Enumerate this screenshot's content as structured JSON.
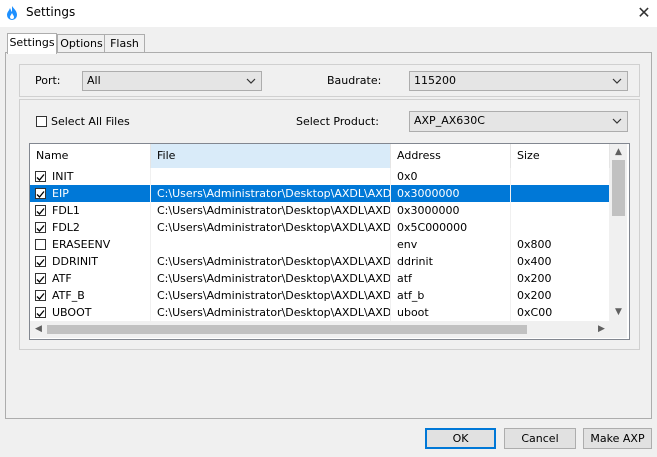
{
  "window": {
    "title": "Settings",
    "close_glyph": "✕"
  },
  "tabs": [
    "Settings",
    "Options",
    "Flash"
  ],
  "port": {
    "label": "Port:",
    "value": "All"
  },
  "baudrate": {
    "label": "Baudrate:",
    "value": "115200"
  },
  "select_all": {
    "label": "Select All Files",
    "checked": false
  },
  "product": {
    "label": "Select Product:",
    "value": "AXP_AX630C"
  },
  "table": {
    "columns": [
      "Name",
      "File",
      "Address",
      "Size"
    ],
    "rows": [
      {
        "checked": true,
        "name": "INIT",
        "file": "",
        "address": "0x0",
        "size": "",
        "selected": false
      },
      {
        "checked": true,
        "name": "EIP",
        "file": "C:\\Users\\Administrator\\Desktop\\AXDL\\AXDL...",
        "address": "0x3000000",
        "size": "",
        "selected": true
      },
      {
        "checked": true,
        "name": "FDL1",
        "file": "C:\\Users\\Administrator\\Desktop\\AXDL\\AXDL...",
        "address": "0x3000000",
        "size": "",
        "selected": false
      },
      {
        "checked": true,
        "name": "FDL2",
        "file": "C:\\Users\\Administrator\\Desktop\\AXDL\\AXDL...",
        "address": "0x5C000000",
        "size": "",
        "selected": false
      },
      {
        "checked": false,
        "name": "ERASEENV",
        "file": "",
        "address": "env",
        "size": "0x800",
        "selected": false
      },
      {
        "checked": true,
        "name": "DDRINIT",
        "file": "C:\\Users\\Administrator\\Desktop\\AXDL\\AXDL...",
        "address": "ddrinit",
        "size": "0x400",
        "selected": false
      },
      {
        "checked": true,
        "name": "ATF",
        "file": "C:\\Users\\Administrator\\Desktop\\AXDL\\AXDL...",
        "address": "atf",
        "size": "0x200",
        "selected": false
      },
      {
        "checked": true,
        "name": "ATF_B",
        "file": "C:\\Users\\Administrator\\Desktop\\AXDL\\AXDL...",
        "address": "atf_b",
        "size": "0x200",
        "selected": false
      },
      {
        "checked": true,
        "name": "UBOOT",
        "file": "C:\\Users\\Administrator\\Desktop\\AXDL\\AXDL...",
        "address": "uboot",
        "size": "0xC00",
        "selected": false
      }
    ]
  },
  "buttons": {
    "ok": "OK",
    "cancel": "Cancel",
    "make_axp": "Make AXP"
  },
  "colors": {
    "selection": "#0078d7",
    "sorted_header": "#d9ebf9",
    "flame": "#1e90ff"
  }
}
